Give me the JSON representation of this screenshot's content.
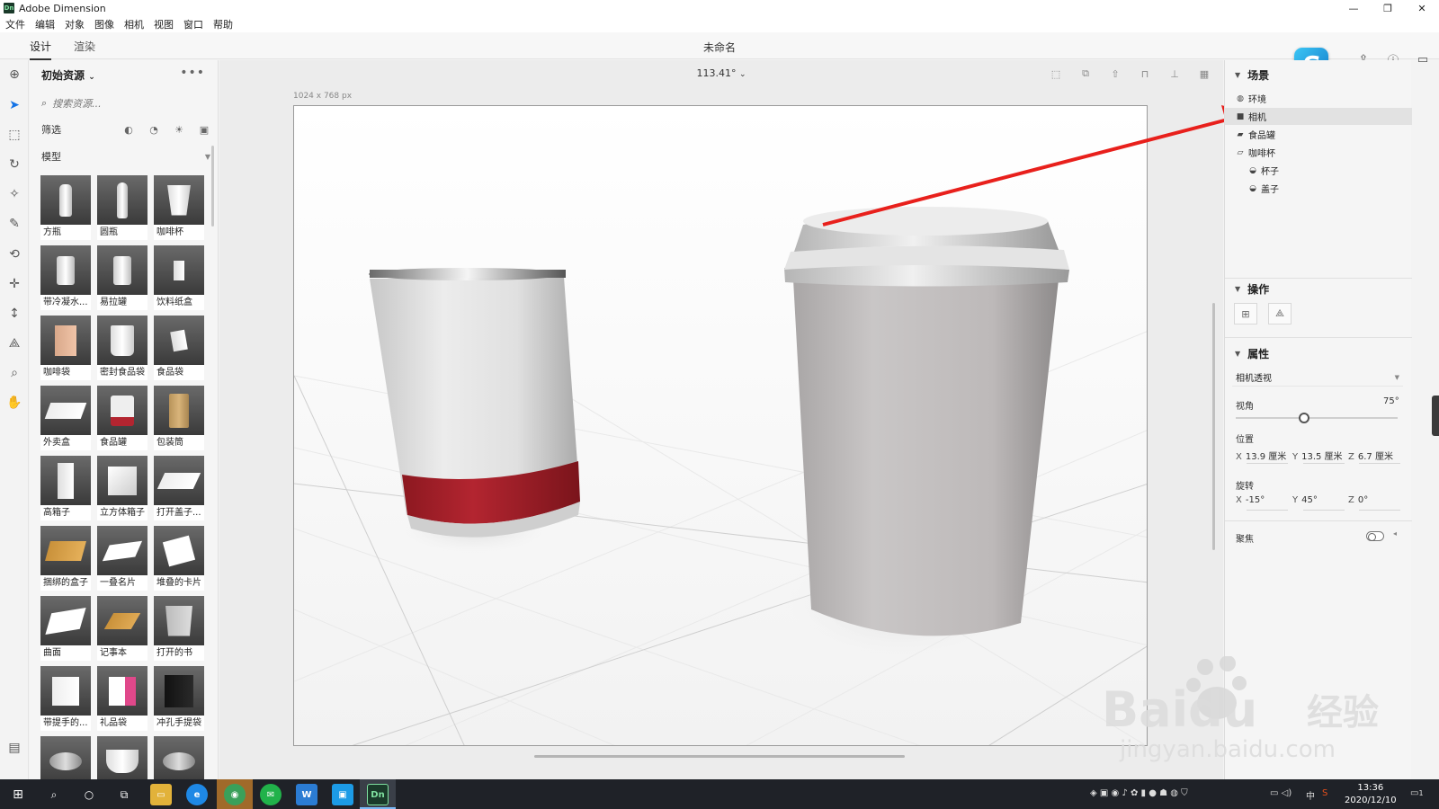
{
  "window": {
    "title": "Adobe Dimension",
    "logo_text": "Dn",
    "controls": [
      "—",
      "❐",
      "✕"
    ]
  },
  "menu": [
    "文件",
    "编辑",
    "对象",
    "图像",
    "相机",
    "视图",
    "窗口",
    "帮助"
  ],
  "modes": {
    "design": "设计",
    "render": "渲染"
  },
  "document_title": "未命名",
  "assets": {
    "header": "初始资源",
    "search_placeholder": "搜索资源...",
    "filter_label": "筛选",
    "section_label": "模型",
    "items": [
      {
        "label": "方瓶",
        "shape": "bottle"
      },
      {
        "label": "圆瓶",
        "shape": "bottle-round"
      },
      {
        "label": "咖啡杯",
        "shape": "cup"
      },
      {
        "label": "带冷凝水...",
        "shape": "can"
      },
      {
        "label": "易拉罐",
        "shape": "can"
      },
      {
        "label": "饮料纸盒",
        "shape": "carton"
      },
      {
        "label": "咖啡袋",
        "shape": "bag-coffee"
      },
      {
        "label": "密封食品袋",
        "shape": "pouch"
      },
      {
        "label": "食品袋",
        "shape": "pouch-small"
      },
      {
        "label": "外卖盒",
        "shape": "takeout"
      },
      {
        "label": "食品罐",
        "shape": "jar"
      },
      {
        "label": "包装筒",
        "shape": "tube"
      },
      {
        "label": "高箱子",
        "shape": "tall-box"
      },
      {
        "label": "立方体箱子",
        "shape": "cube"
      },
      {
        "label": "打开盖子...",
        "shape": "open-box"
      },
      {
        "label": "捆绑的盒子",
        "shape": "tied-box"
      },
      {
        "label": "一叠名片",
        "shape": "cards"
      },
      {
        "label": "堆叠的卡片",
        "shape": "stacked-cards"
      },
      {
        "label": "曲面",
        "shape": "curved"
      },
      {
        "label": "记事本",
        "shape": "notebook"
      },
      {
        "label": "打开的书",
        "shape": "book"
      },
      {
        "label": "带提手的...",
        "shape": "shopping-bag"
      },
      {
        "label": "礼品袋",
        "shape": "gift-bag"
      },
      {
        "label": "冲孔手提袋",
        "shape": "black-bag"
      },
      {
        "label": "",
        "shape": "tin"
      },
      {
        "label": "",
        "shape": "bowl"
      },
      {
        "label": "",
        "shape": "tin"
      }
    ]
  },
  "canvas": {
    "zoom": "113.41°",
    "doc_size": "1024 x 768 px"
  },
  "scene": {
    "header": "场景",
    "items": [
      {
        "label": "环境",
        "icon": "globe-icon",
        "depth": 0,
        "selected": false
      },
      {
        "label": "相机",
        "icon": "camera-icon",
        "depth": 0,
        "selected": true
      },
      {
        "label": "食品罐",
        "icon": "folder-icon",
        "depth": 0,
        "selected": false
      },
      {
        "label": "咖啡杯",
        "icon": "folder-open-icon",
        "depth": 0,
        "selected": false
      },
      {
        "label": "杯子",
        "icon": "model-icon",
        "depth": 1,
        "selected": false
      },
      {
        "label": "盖子",
        "icon": "model-icon",
        "depth": 1,
        "selected": false
      }
    ]
  },
  "actions": {
    "header": "操作"
  },
  "properties": {
    "header": "属性",
    "camera_mode": "相机透视",
    "fov_label": "视角",
    "fov_value": "75°",
    "position_label": "位置",
    "position": {
      "x": "13.9 厘米",
      "y": "13.5 厘米",
      "z": "6.7 厘米"
    },
    "rotation_label": "旋转",
    "rotation": {
      "x": "-15°",
      "y": "45°",
      "z": "0°"
    },
    "focus_label": "聚焦",
    "focus_on": false
  },
  "taskbar": {
    "time": "13:36",
    "date": "2020/12/10",
    "ime": "中",
    "notification_count": "1"
  },
  "watermark": {
    "brand": "Baidu",
    "cn": "经验",
    "url": "jingyan.baidu.com"
  },
  "colors": {
    "accent": "#1473e6",
    "arrow": "#e8201c",
    "can_band": "#a5202a"
  }
}
